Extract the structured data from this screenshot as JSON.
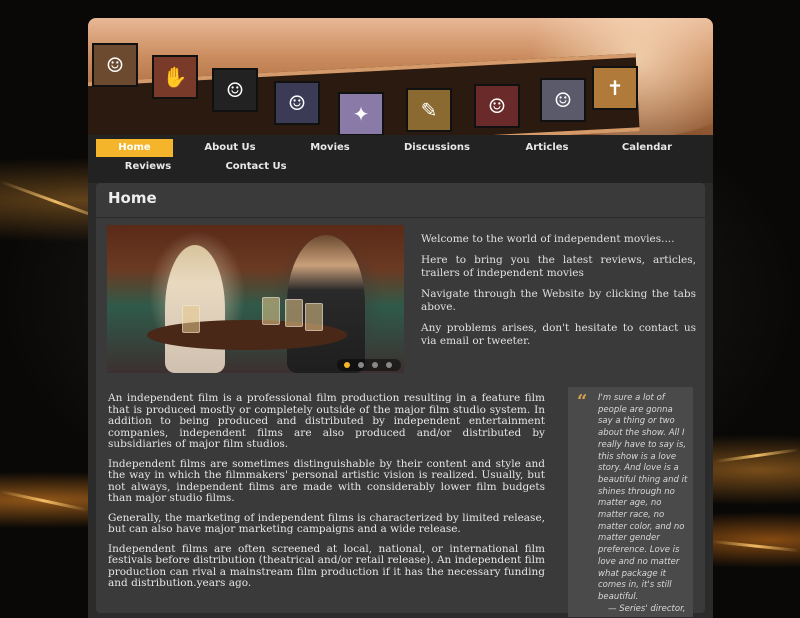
{
  "nav": {
    "items": [
      {
        "label": "Home",
        "active": true
      },
      {
        "label": "About Us"
      },
      {
        "label": "Movies"
      },
      {
        "label": "Discussions"
      },
      {
        "label": "Articles"
      },
      {
        "label": "Calendar"
      },
      {
        "label": "Reviews"
      },
      {
        "label": "Contact Us"
      }
    ]
  },
  "page": {
    "title": "Home"
  },
  "welcome": {
    "p1": "Welcome to the world of independent movies....",
    "p2": "Here to bring you the latest reviews, articles, trailers of independent movies",
    "p3": "Navigate through the Website by clicking the tabs above.",
    "p4": "Any problems arises, don't hesitate to contact us via email or tweeter."
  },
  "slider": {
    "dot_count": 4,
    "active_index": 0
  },
  "article": {
    "p1": " An independent film is a professional film production resulting in a feature film that is produced mostly or completely outside of the major film studio system. In addition to being produced and distributed by independent entertainment companies, independent films are also produced and/or distributed by subsidiaries of major film studios.",
    "p2": "Independent films are sometimes distinguishable by their content and style and the way in which the filmmakers' personal artistic vision is realized. Usually, but not always, independent films are made with considerably lower film budgets than major studio films.",
    "p3": "Generally, the marketing of independent films is characterized by limited release, but can also have major marketing campaigns and a wide release.",
    "p4": "Independent films are often screened at local, national, or international film festivals before distribution (theatrical and/or retail release). An independent film production can rival a mainstream film production if it has the necessary funding and distribution.years ago."
  },
  "quote": {
    "mark": "“",
    "text": "I'm sure a lot of people are gonna say a thing or two about the show. All I really have to say is, this show is a love story. And love is a beautiful thing and it shines through no matter age, no matter race, no matter color, and no matter gender preference. Love is love and no matter what package it comes in, it's still beautiful.",
    "attribution": "— Series' director,"
  },
  "colors": {
    "accent": "#f4b52a",
    "content_bg": "#3a3a3a",
    "nav_bg": "#222222"
  }
}
